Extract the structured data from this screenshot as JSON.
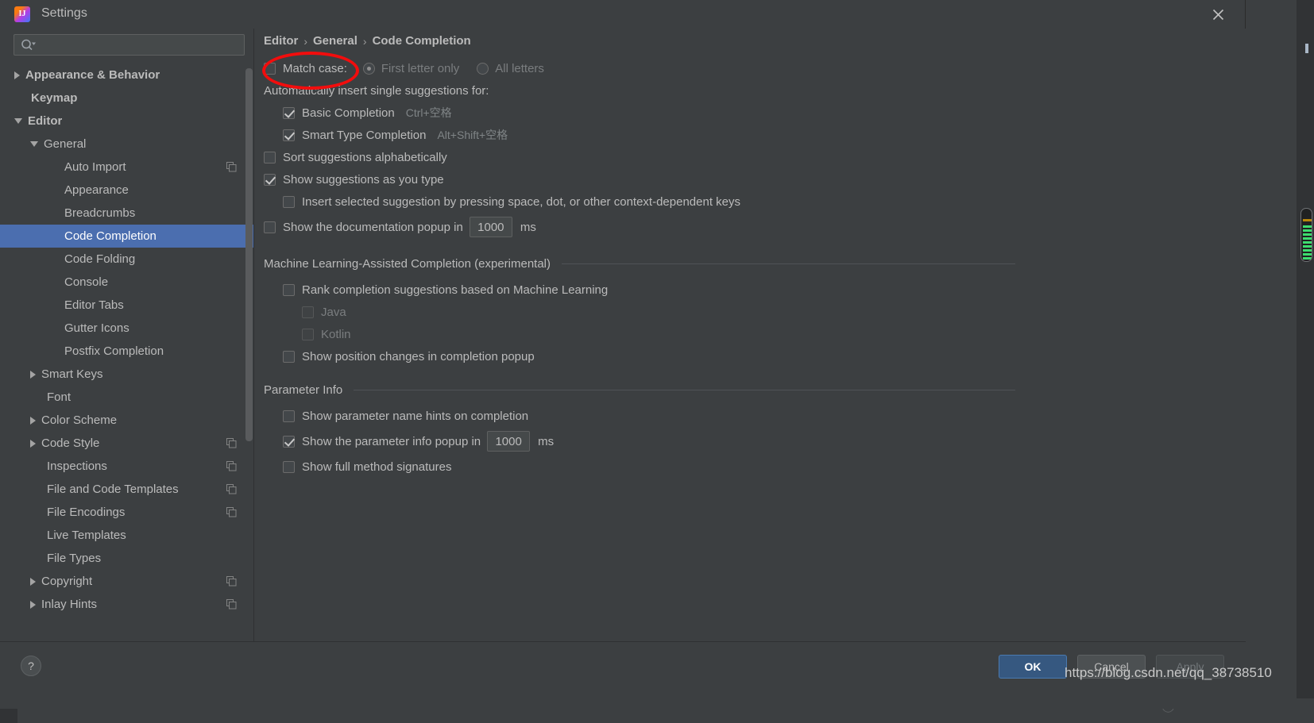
{
  "window": {
    "title": "Settings",
    "app_icon": "intellij-idea-icon",
    "close_icon": "close-icon"
  },
  "search": {
    "placeholder": "",
    "value": "",
    "icon": "search-icon"
  },
  "sidebar": {
    "scrollbar": "sidebar-scrollbar",
    "items": [
      {
        "label": "Appearance & Behavior",
        "indent": 0,
        "arrow": "right",
        "bold": true,
        "selected": false,
        "badge": false
      },
      {
        "label": "Keymap",
        "indent": 0,
        "arrow": "none",
        "bold": true,
        "selected": false,
        "badge": false
      },
      {
        "label": "Editor",
        "indent": 0,
        "arrow": "down",
        "bold": true,
        "selected": false,
        "badge": false
      },
      {
        "label": "General",
        "indent": 1,
        "arrow": "down",
        "bold": false,
        "selected": false,
        "badge": false
      },
      {
        "label": "Auto Import",
        "indent": 2,
        "arrow": "none",
        "bold": false,
        "selected": false,
        "badge": true
      },
      {
        "label": "Appearance",
        "indent": 2,
        "arrow": "none",
        "bold": false,
        "selected": false,
        "badge": false
      },
      {
        "label": "Breadcrumbs",
        "indent": 2,
        "arrow": "none",
        "bold": false,
        "selected": false,
        "badge": false
      },
      {
        "label": "Code Completion",
        "indent": 2,
        "arrow": "none",
        "bold": false,
        "selected": true,
        "badge": false
      },
      {
        "label": "Code Folding",
        "indent": 2,
        "arrow": "none",
        "bold": false,
        "selected": false,
        "badge": false
      },
      {
        "label": "Console",
        "indent": 2,
        "arrow": "none",
        "bold": false,
        "selected": false,
        "badge": false
      },
      {
        "label": "Editor Tabs",
        "indent": 2,
        "arrow": "none",
        "bold": false,
        "selected": false,
        "badge": false
      },
      {
        "label": "Gutter Icons",
        "indent": 2,
        "arrow": "none",
        "bold": false,
        "selected": false,
        "badge": false
      },
      {
        "label": "Postfix Completion",
        "indent": 2,
        "arrow": "none",
        "bold": false,
        "selected": false,
        "badge": false
      },
      {
        "label": "Smart Keys",
        "indent": 1,
        "arrow": "right",
        "bold": false,
        "selected": false,
        "badge": false
      },
      {
        "label": "Font",
        "indent": 1,
        "arrow": "none",
        "bold": false,
        "selected": false,
        "badge": false
      },
      {
        "label": "Color Scheme",
        "indent": 1,
        "arrow": "right",
        "bold": false,
        "selected": false,
        "badge": false
      },
      {
        "label": "Code Style",
        "indent": 1,
        "arrow": "right",
        "bold": false,
        "selected": false,
        "badge": true
      },
      {
        "label": "Inspections",
        "indent": 1,
        "arrow": "none",
        "bold": false,
        "selected": false,
        "badge": true
      },
      {
        "label": "File and Code Templates",
        "indent": 1,
        "arrow": "none",
        "bold": false,
        "selected": false,
        "badge": true
      },
      {
        "label": "File Encodings",
        "indent": 1,
        "arrow": "none",
        "bold": false,
        "selected": false,
        "badge": true
      },
      {
        "label": "Live Templates",
        "indent": 1,
        "arrow": "none",
        "bold": false,
        "selected": false,
        "badge": false
      },
      {
        "label": "File Types",
        "indent": 1,
        "arrow": "none",
        "bold": false,
        "selected": false,
        "badge": false
      },
      {
        "label": "Copyright",
        "indent": 1,
        "arrow": "right",
        "bold": false,
        "selected": false,
        "badge": true
      },
      {
        "label": "Inlay Hints",
        "indent": 1,
        "arrow": "right",
        "bold": false,
        "selected": false,
        "badge": true
      }
    ]
  },
  "breadcrumb": {
    "parts": [
      "Editor",
      "General",
      "Code Completion"
    ],
    "separator": "›"
  },
  "main": {
    "match_case": {
      "label": "Match case:",
      "checked": false,
      "options": [
        {
          "label": "First letter only",
          "selected": true
        },
        {
          "label": "All letters",
          "selected": false
        }
      ]
    },
    "auto_insert_label": "Automatically insert single suggestions for:",
    "auto_insert_items": [
      {
        "label": "Basic Completion",
        "shortcut": "Ctrl+空格",
        "checked": true
      },
      {
        "label": "Smart Type Completion",
        "shortcut": "Alt+Shift+空格",
        "checked": true
      }
    ],
    "sort_alphabetically": {
      "label": "Sort suggestions alphabetically",
      "checked": false
    },
    "show_as_you_type": {
      "label": "Show suggestions as you type",
      "checked": true
    },
    "insert_selected": {
      "label": "Insert selected suggestion by pressing space, dot, or other context-dependent keys",
      "checked": false
    },
    "doc_popup": {
      "label": "Show the documentation popup in",
      "checked": false,
      "value": "1000",
      "unit": "ms"
    },
    "ml_section": {
      "title": "Machine Learning-Assisted Completion (experimental)",
      "rank": {
        "label": "Rank completion suggestions based on Machine Learning",
        "checked": false
      },
      "languages": [
        {
          "label": "Java",
          "checked": false,
          "disabled": true
        },
        {
          "label": "Kotlin",
          "checked": false,
          "disabled": true
        }
      ],
      "position_changes": {
        "label": "Show position changes in completion popup",
        "checked": false
      }
    },
    "param_section": {
      "title": "Parameter Info",
      "name_hints": {
        "label": "Show parameter name hints on completion",
        "checked": false
      },
      "popup_delay": {
        "label": "Show the parameter info popup in",
        "checked": true,
        "value": "1000",
        "unit": "ms"
      },
      "full_signatures": {
        "label": "Show full method signatures",
        "checked": false
      }
    }
  },
  "footer": {
    "help_label": "?",
    "ok": "OK",
    "cancel": "Cancel",
    "apply": "Apply"
  },
  "annotation": {
    "ellipse_color": "#f20d0d",
    "target": "Match case:"
  },
  "watermark": {
    "text": "https://blog.csdn.net/qq_38738510"
  },
  "colors": {
    "dialog_bg": "#3c3f41",
    "selection": "#4b6eaf",
    "ok_button": "#365880",
    "text": "#bbbbbb",
    "dim_text": "#7a7d7f"
  }
}
